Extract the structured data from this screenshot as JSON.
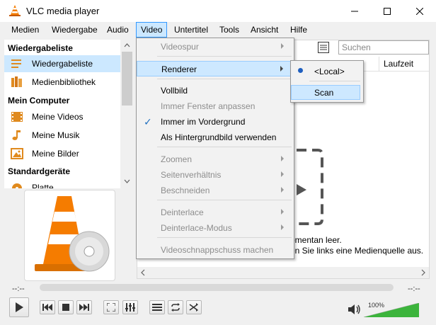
{
  "window": {
    "title": "VLC media player"
  },
  "menubar": {
    "items": [
      "Medien",
      "Wiedergabe",
      "Audio",
      "Video",
      "Untertitel",
      "Tools",
      "Ansicht",
      "Hilfe"
    ]
  },
  "sidebar": {
    "sections": [
      {
        "title": "Wiedergabeliste",
        "items": [
          "Wiedergabeliste",
          "Medienbibliothek"
        ]
      },
      {
        "title": "Mein Computer",
        "items": [
          "Meine Videos",
          "Meine Musik",
          "Meine Bilder"
        ]
      },
      {
        "title": "Standardgeräte",
        "items": [
          "Platte"
        ]
      }
    ],
    "selected_item": "Wiedergabeliste"
  },
  "playlist": {
    "search_placeholder": "Suchen",
    "columns": [
      "Laufzeit"
    ],
    "empty_line1": "omentan leer.",
    "empty_line2": "en Sie links eine Medienquelle aus."
  },
  "video_menu": {
    "items": [
      {
        "label": "Videospur",
        "disabled": true,
        "submenu": true
      },
      {
        "label": "Renderer",
        "disabled": false,
        "submenu": true,
        "highlighted": true
      },
      {
        "label": "Vollbild",
        "disabled": false
      },
      {
        "label": "Immer Fenster anpassen",
        "disabled": true
      },
      {
        "label": "Immer im Vordergrund",
        "disabled": false,
        "checked": true
      },
      {
        "label": "Als Hintergrundbild verwenden",
        "disabled": false
      },
      {
        "label": "Zoomen",
        "disabled": true,
        "submenu": true
      },
      {
        "label": "Seitenverhältnis",
        "disabled": true,
        "submenu": true
      },
      {
        "label": "Beschneiden",
        "disabled": true,
        "submenu": true
      },
      {
        "label": "Deinterlace",
        "disabled": true,
        "submenu": true
      },
      {
        "label": "Deinterlace-Modus",
        "disabled": true,
        "submenu": true
      },
      {
        "label": "Videoschnappschuss machen",
        "disabled": true
      }
    ]
  },
  "renderer_submenu": {
    "items": [
      {
        "label": "<Local>",
        "selected": true
      },
      {
        "label": "Scan",
        "highlighted": true
      }
    ]
  },
  "player": {
    "time_elapsed": "--:--",
    "time_total": "--:--",
    "volume_label": "100%",
    "volume_level": 1.0
  },
  "colors": {
    "accent": "#cce8ff",
    "accent_border": "#3399ff",
    "vlc_orange": "#f57c00",
    "volume_green": "#3cb43c"
  }
}
